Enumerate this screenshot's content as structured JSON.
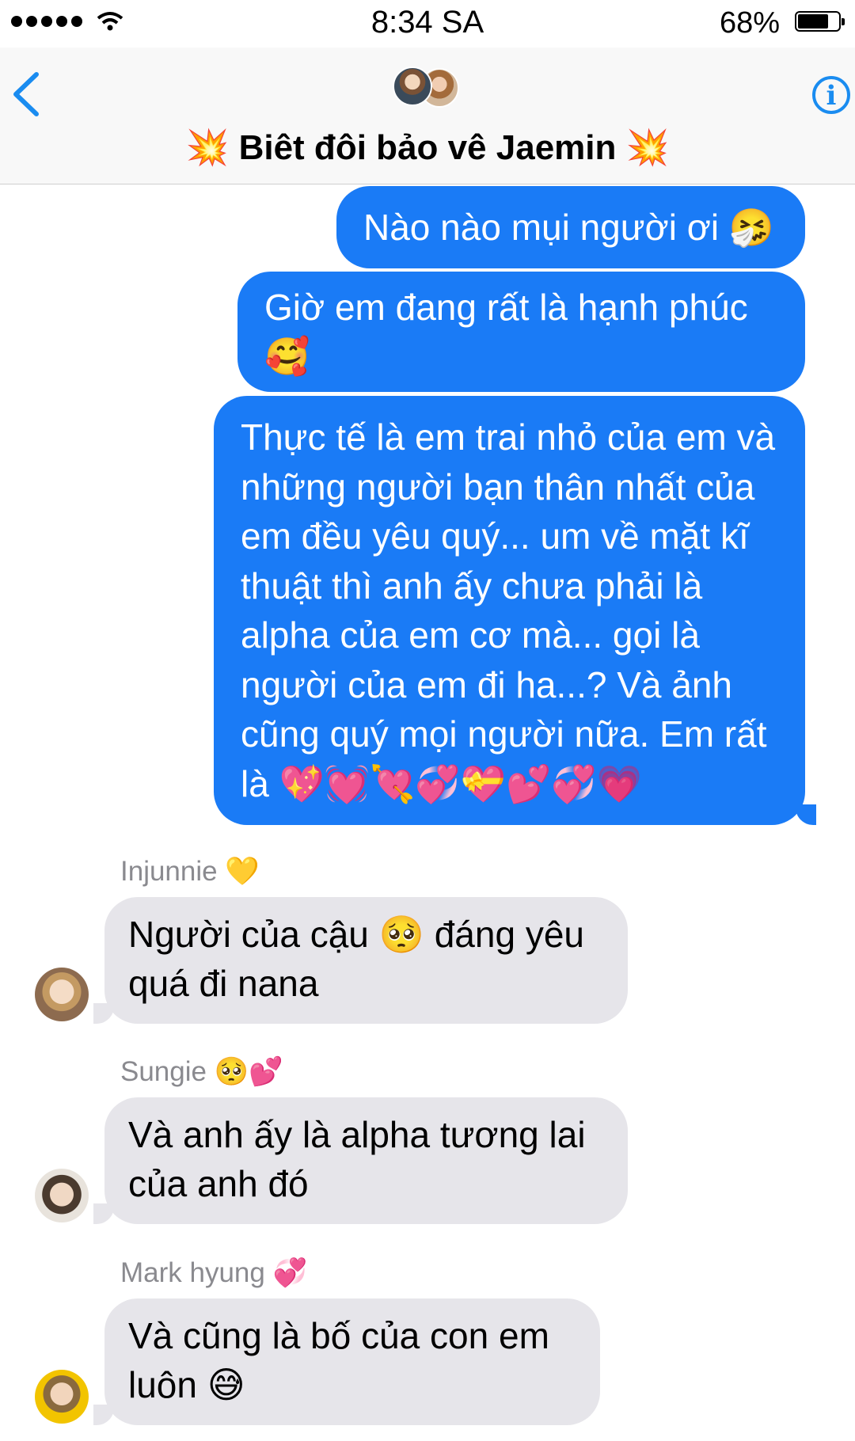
{
  "status_bar": {
    "time": "8:34 SA",
    "battery": "68%"
  },
  "header": {
    "title": "💥 Biêt đôi bảo vê Jaemin 💥"
  },
  "messages_out": [
    "Nào nào mụi người ơi 🤧",
    "Giờ em đang rất là hạnh phúc 🥰",
    "Thực tế là em trai nhỏ của em và những người bạn thân nhất của em đều yêu quý... um về mặt kĩ thuật thì anh ấy chưa phải là alpha của em cơ mà... gọi là người của em đi ha...? Và ảnh cũng quý mọi người nữa. Em rất là 💖💓💘💞💝💕💞💗"
  ],
  "messages_in": [
    {
      "sender": "Injunnie 💛",
      "text": "Người của cậu 🥺 đáng yêu quá đi nana"
    },
    {
      "sender": "Sungie 🥺💕",
      "text": "Và anh ấy là alpha tương lai của anh đó"
    },
    {
      "sender": "Mark hyung 💞",
      "text": "Và cũng là bố của con em luôn 😅"
    }
  ],
  "colors": {
    "outgoing": "#1a7bf6",
    "incoming": "#e6e5ea",
    "accent": "#1a8cf0"
  }
}
